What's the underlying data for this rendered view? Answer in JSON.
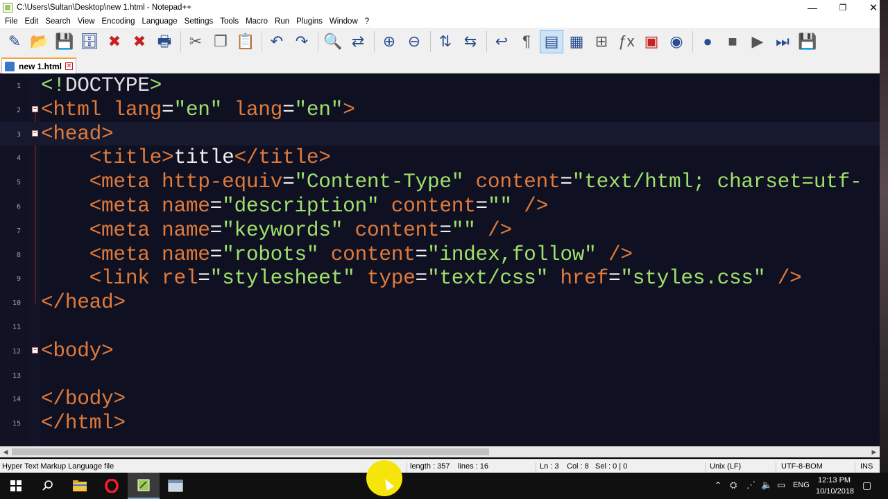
{
  "window": {
    "title": "C:\\Users\\Sultan\\Desktop\\new 1.html - Notepad++",
    "controls": [
      "—",
      "❐",
      "✕"
    ]
  },
  "menu": [
    "File",
    "Edit",
    "Search",
    "View",
    "Encoding",
    "Language",
    "Settings",
    "Tools",
    "Macro",
    "Run",
    "Plugins",
    "Window",
    "?"
  ],
  "toolbar": {
    "icons": [
      {
        "name": "new-file-icon",
        "glyph": "✎"
      },
      {
        "name": "open-file-icon",
        "glyph": "📂"
      },
      {
        "name": "save-icon",
        "glyph": "💾"
      },
      {
        "name": "save-all-icon",
        "glyph": "🗄"
      },
      {
        "name": "close-icon",
        "glyph": "✖"
      },
      {
        "name": "close-all-icon",
        "glyph": "✖"
      },
      {
        "name": "print-icon",
        "glyph": "🖶"
      },
      {
        "name": "cut-icon",
        "glyph": "✂"
      },
      {
        "name": "copy-icon",
        "glyph": "❐"
      },
      {
        "name": "paste-icon",
        "glyph": "📋"
      },
      {
        "name": "undo-icon",
        "glyph": "↶"
      },
      {
        "name": "redo-icon",
        "glyph": "↷"
      },
      {
        "name": "find-icon",
        "glyph": "🔍"
      },
      {
        "name": "replace-icon",
        "glyph": "⇄"
      },
      {
        "name": "zoom-in-icon",
        "glyph": "⊕"
      },
      {
        "name": "zoom-out-icon",
        "glyph": "⊖"
      },
      {
        "name": "sync-vertical-icon",
        "glyph": "⇅"
      },
      {
        "name": "sync-horizontal-icon",
        "glyph": "⇆"
      },
      {
        "name": "word-wrap-icon",
        "glyph": "↩"
      },
      {
        "name": "show-all-characters-icon",
        "glyph": "¶"
      },
      {
        "name": "indent-guide-icon",
        "glyph": "▤"
      },
      {
        "name": "document-map-icon",
        "glyph": "▦"
      },
      {
        "name": "function-list-icon",
        "glyph": "⊞"
      },
      {
        "name": "function-icon",
        "glyph": "ƒx"
      },
      {
        "name": "folder-as-workspace-icon",
        "glyph": "▣"
      },
      {
        "name": "monitoring-icon",
        "glyph": "◉"
      },
      {
        "name": "record-macro-icon",
        "glyph": "●"
      },
      {
        "name": "stop-macro-icon",
        "glyph": "■"
      },
      {
        "name": "play-macro-icon",
        "glyph": "▶"
      },
      {
        "name": "run-macro-multiple-icon",
        "glyph": "⏭"
      },
      {
        "name": "save-macro-icon",
        "glyph": "💾"
      }
    ]
  },
  "tab": {
    "label": "new 1.html",
    "close": "✕"
  },
  "editor": {
    "current_line": 3,
    "lines": [
      {
        "n": "1"
      },
      {
        "n": "2"
      },
      {
        "n": "3"
      },
      {
        "n": "4"
      },
      {
        "n": "5"
      },
      {
        "n": "6"
      },
      {
        "n": "7"
      },
      {
        "n": "8"
      },
      {
        "n": "9"
      },
      {
        "n": "10"
      },
      {
        "n": "11"
      },
      {
        "n": "12"
      },
      {
        "n": "13"
      },
      {
        "n": "14"
      },
      {
        "n": "15"
      }
    ],
    "code": {
      "l1": {
        "open": "<!",
        "doctype": "DOCTYPE",
        "close": ">"
      },
      "l2": {
        "tag": "<html",
        "attr1": " lang",
        "eq1": "=",
        "val1": "\"en\"",
        "attr2": " lang",
        "eq2": "=",
        "val2": "\"en\"",
        "close": ">"
      },
      "l3": {
        "tag": "<head>"
      },
      "l4": {
        "indent": "    ",
        "open": "<title>",
        "text": "title",
        "close": "</title>"
      },
      "l5": {
        "indent": "    ",
        "tag": "<meta",
        "attr1": " http-equiv",
        "eq1": "=",
        "val1": "\"Content-Type\"",
        "attr2": " content",
        "eq2": "=",
        "val2": "\"text/html; charset=utf-"
      },
      "l6": {
        "indent": "    ",
        "tag": "<meta",
        "attr1": " name",
        "eq1": "=",
        "val1": "\"description\"",
        "attr2": " content",
        "eq2": "=",
        "val2": "\"\"",
        "close": " />"
      },
      "l7": {
        "indent": "    ",
        "tag": "<meta",
        "attr1": " name",
        "eq1": "=",
        "val1": "\"keywords\"",
        "attr2": " content",
        "eq2": "=",
        "val2": "\"\"",
        "close": " />"
      },
      "l8": {
        "indent": "    ",
        "tag": "<meta",
        "attr1": " name",
        "eq1": "=",
        "val1": "\"robots\"",
        "attr2": " content",
        "eq2": "=",
        "val2": "\"index,follow\"",
        "close": " />"
      },
      "l9": {
        "indent": "    ",
        "tag": "<link",
        "attr1": " rel",
        "eq1": "=",
        "val1": "\"stylesheet\"",
        "attr2": " type",
        "eq2": "=",
        "val2": "\"text/css\"",
        "attr3": " href",
        "eq3": "=",
        "val3": "\"styles.css\"",
        "close": " />"
      },
      "l10": {
        "tag": "</head>"
      },
      "l12": {
        "tag": "<body>"
      },
      "l14": {
        "tag": "</body>"
      },
      "l15": {
        "tag": "</html>"
      }
    }
  },
  "statusbar": {
    "language": "Hyper Text Markup Language file",
    "length": "length : 357",
    "lines": "lines : 16",
    "ln": "Ln : 3",
    "col": "Col : 8",
    "sel": "Sel : 0 | 0",
    "eol": "Unix (LF)",
    "encoding": "UTF-8-BOM",
    "mode": "INS"
  },
  "taskbar": {
    "lang": "ENG",
    "time": "12:13 PM",
    "date": "10/10/2018"
  },
  "colors": {
    "editor_bg": "#0f1123",
    "tag": "#e07a3a",
    "value": "#9fe06a",
    "text": "#f0f0f0",
    "tab_accent": "#f7a13a"
  }
}
